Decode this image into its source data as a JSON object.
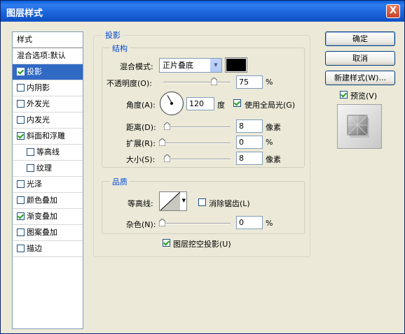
{
  "window": {
    "title": "图层样式",
    "close_glyph": "X"
  },
  "sidebar": {
    "header": "样式",
    "items": [
      {
        "label": "混合选项:默认",
        "checkbox": false,
        "checked": false,
        "selected": false,
        "indent": false
      },
      {
        "label": "投影",
        "checkbox": true,
        "checked": true,
        "selected": true,
        "indent": false
      },
      {
        "label": "内阴影",
        "checkbox": true,
        "checked": false,
        "selected": false,
        "indent": false
      },
      {
        "label": "外发光",
        "checkbox": true,
        "checked": false,
        "selected": false,
        "indent": false
      },
      {
        "label": "内发光",
        "checkbox": true,
        "checked": false,
        "selected": false,
        "indent": false
      },
      {
        "label": "斜面和浮雕",
        "checkbox": true,
        "checked": true,
        "selected": false,
        "indent": false
      },
      {
        "label": "等高线",
        "checkbox": true,
        "checked": false,
        "selected": false,
        "indent": true
      },
      {
        "label": "纹理",
        "checkbox": true,
        "checked": false,
        "selected": false,
        "indent": true
      },
      {
        "label": "光泽",
        "checkbox": true,
        "checked": false,
        "selected": false,
        "indent": false
      },
      {
        "label": "颜色叠加",
        "checkbox": true,
        "checked": false,
        "selected": false,
        "indent": false
      },
      {
        "label": "渐变叠加",
        "checkbox": true,
        "checked": true,
        "selected": false,
        "indent": false
      },
      {
        "label": "图案叠加",
        "checkbox": true,
        "checked": false,
        "selected": false,
        "indent": false
      },
      {
        "label": "描边",
        "checkbox": true,
        "checked": false,
        "selected": false,
        "indent": false
      }
    ]
  },
  "panel": {
    "title": "投影",
    "structure": {
      "title": "结构",
      "blend_mode_label": "混合模式:",
      "blend_mode_value": "正片叠底",
      "shadow_color": "#000000",
      "opacity_label": "不透明度(O):",
      "opacity_value": "75",
      "opacity_unit": "%",
      "opacity_level": 0.75,
      "angle_label": "角度(A):",
      "angle_value": "120",
      "angle_unit": "度",
      "global_light_label": "使用全局光(G)",
      "global_light_checked": true,
      "distance_label": "距离(D):",
      "distance_value": "8",
      "distance_unit": "像素",
      "spread_label": "扩展(R):",
      "spread_value": "0",
      "spread_unit": "%",
      "size_label": "大小(S):",
      "size_value": "8",
      "size_unit": "像素"
    },
    "quality": {
      "title": "品质",
      "contour_label": "等高线:",
      "antialias_label": "消除锯齿(L)",
      "antialias_checked": false,
      "noise_label": "杂色(N):",
      "noise_value": "0",
      "noise_unit": "%"
    },
    "knockout_label": "图层挖空投影(U)",
    "knockout_checked": true
  },
  "buttons": {
    "ok": "确定",
    "cancel": "取消",
    "new_style": "新建样式(W)...",
    "preview_label": "预览(V)",
    "preview_checked": true
  }
}
